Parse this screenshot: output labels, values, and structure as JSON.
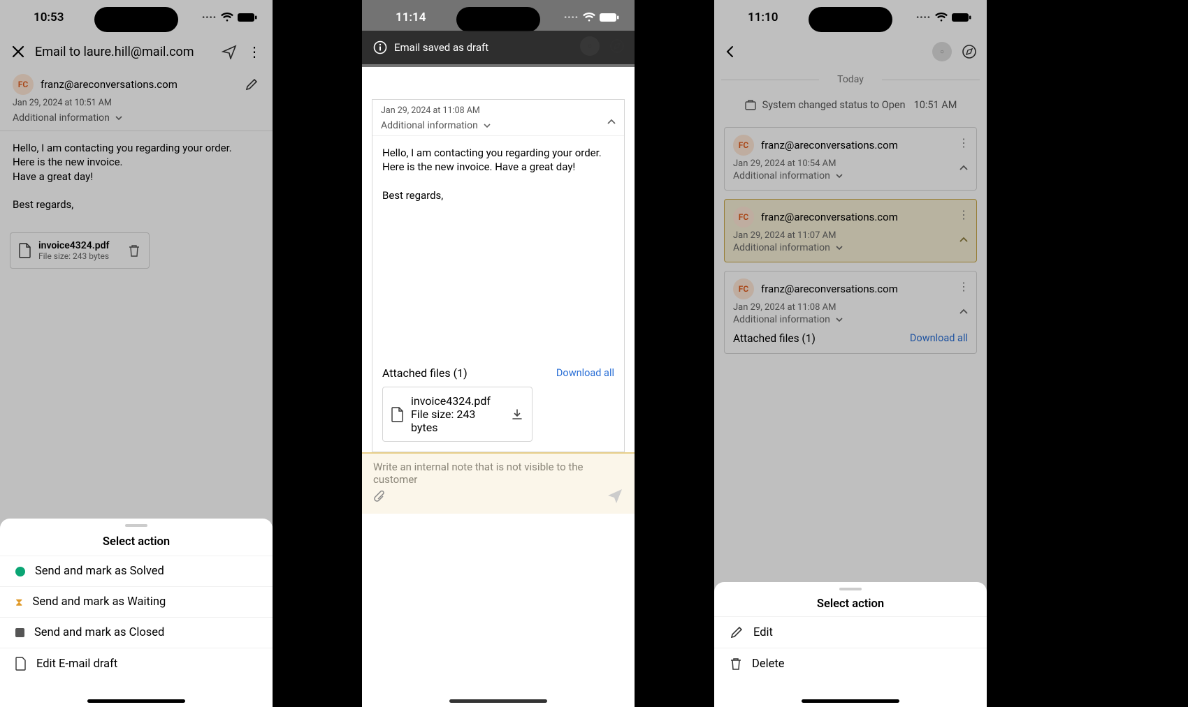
{
  "phone1": {
    "status_time": "10:53",
    "title": "Email to laure.hill@mail.com",
    "sender_initials": "FC",
    "sender_email": "franz@areconversations.com",
    "timestamp": "Jan 29, 2024 at 10:51 AM",
    "additional_info_label": "Additional information",
    "body_line1": "Hello, I am contacting you regarding your order.",
    "body_line2": "Here is the new invoice.",
    "body_line3": "Have a great day!",
    "body_signoff": "Best regards,",
    "attachment": {
      "name": "invoice4324.pdf",
      "size": "File size: 243 bytes"
    },
    "sheet_title": "Select action",
    "sheet": {
      "solved": "Send and mark as Solved",
      "waiting": "Send and mark as Waiting",
      "closed": "Send and mark as Closed",
      "draft": "Edit E-mail draft"
    }
  },
  "phone2": {
    "status_time": "11:14",
    "toast": "Email saved as draft",
    "timestamp": "Jan 29, 2024 at 11:08 AM",
    "additional_info_label": "Additional information",
    "body": "Hello, I am contacting you regarding your order.  Here is the new invoice. Have a great day!",
    "body_signoff": "Best regards,",
    "attached_label": "Attached files (1)",
    "download_all": "Download all",
    "attachment": {
      "name": "invoice4324.pdf",
      "size": "File size: 243 bytes"
    },
    "note_placeholder": "Write an internal note that is not visible to the customer"
  },
  "phone3": {
    "status_time": "11:10",
    "today_label": "Today",
    "system_line": "System changed status to Open",
    "system_time": "10:51 AM",
    "cards": [
      {
        "initials": "FC",
        "email": "franz@areconversations.com",
        "date": "Jan 29, 2024 at 10:54 AM",
        "addl": "Additional information"
      },
      {
        "initials": "FC",
        "email": "franz@areconversations.com",
        "date": "Jan 29, 2024 at 11:07 AM",
        "addl": "Additional information"
      },
      {
        "initials": "FC",
        "email": "franz@areconversations.com",
        "date": "Jan 29, 2024 at 11:08 AM",
        "addl": "Additional information"
      }
    ],
    "attached_label": "Attached files (1)",
    "download_all": "Download all",
    "sheet_title": "Select action",
    "sheet": {
      "edit": "Edit",
      "delete": "Delete"
    }
  }
}
